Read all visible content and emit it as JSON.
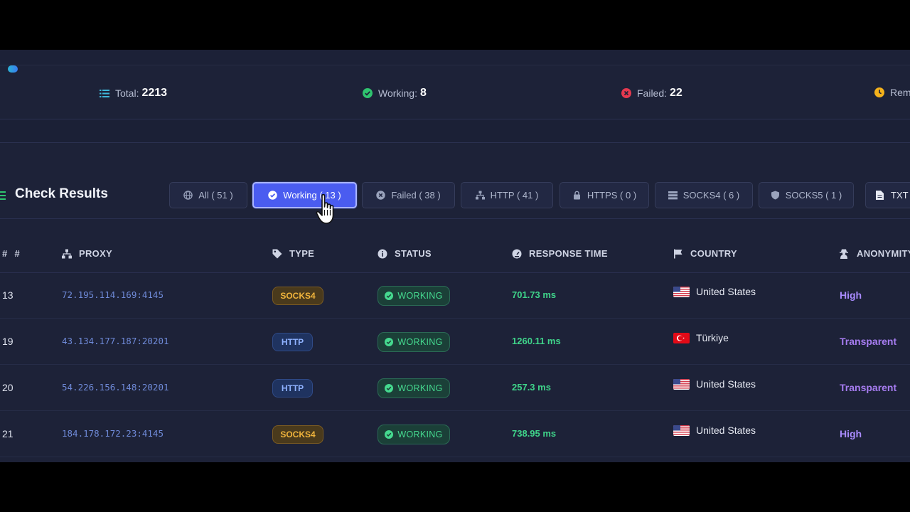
{
  "stats": {
    "total_label": "Total:",
    "total_value": "2213",
    "working_label": "Working:",
    "working_value": "8",
    "failed_label": "Failed:",
    "failed_value": "22",
    "remaining_label": "Rema"
  },
  "results": {
    "title": "Check Results",
    "filters": [
      {
        "label": "All ( 51 )",
        "icon": "globe-icon"
      },
      {
        "label": "Working ( 13 )",
        "icon": "check-circle-icon",
        "active": true
      },
      {
        "label": "Failed ( 38 )",
        "icon": "x-circle-icon"
      },
      {
        "label": "HTTP ( 41 )",
        "icon": "network-icon"
      },
      {
        "label": "HTTPS ( 0 )",
        "icon": "lock-icon"
      },
      {
        "label": "SOCKS4 ( 6 )",
        "icon": "server-icon"
      },
      {
        "label": "SOCKS5 ( 1 )",
        "icon": "shield-icon"
      },
      {
        "label": "TXT",
        "icon": "file-icon"
      }
    ]
  },
  "table": {
    "columns": [
      "#",
      "PROXY",
      "TYPE",
      "STATUS",
      "RESPONSE TIME",
      "COUNTRY",
      "ANONYMITY"
    ],
    "hash_prefix": "#",
    "rows": [
      {
        "num": "13",
        "proxy": "72.195.114.169:4145",
        "type": "SOCKS4",
        "status": "WORKING",
        "response": "701.73 ms",
        "country": "United States",
        "anonymity": "High"
      },
      {
        "num": "19",
        "proxy": "43.134.177.187:20201",
        "type": "HTTP",
        "status": "WORKING",
        "response": "1260.11 ms",
        "country": "Türkiye",
        "anonymity": "Transparent"
      },
      {
        "num": "20",
        "proxy": "54.226.156.148:20201",
        "type": "HTTP",
        "status": "WORKING",
        "response": "257.3 ms",
        "country": "United States",
        "anonymity": "Transparent"
      },
      {
        "num": "21",
        "proxy": "184.178.172.23:4145",
        "type": "SOCKS4",
        "status": "WORKING",
        "response": "738.95 ms",
        "country": "United States",
        "anonymity": "High"
      }
    ]
  },
  "colors": {
    "accent": "#4a5cf0",
    "success": "#45d98f",
    "danger": "#e5394f",
    "warning": "#f5b21b",
    "panel": "#1d2238"
  }
}
